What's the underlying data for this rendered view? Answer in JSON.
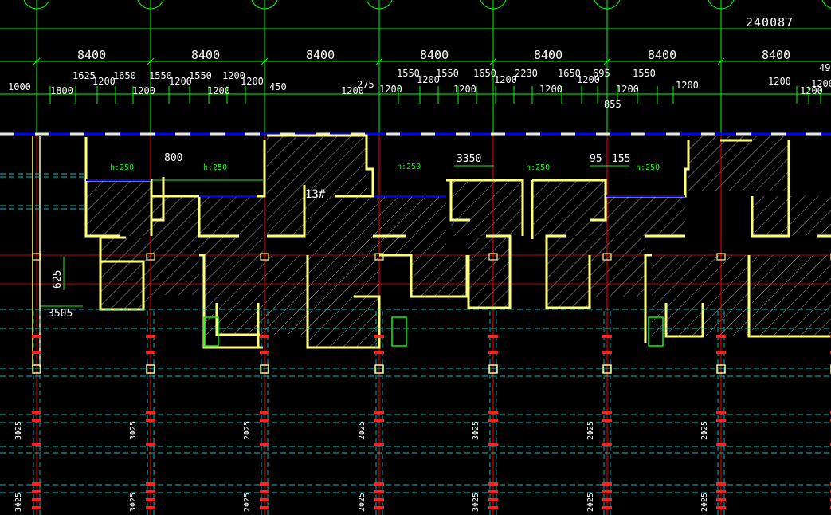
{
  "drawing": {
    "total_dimension": "240087",
    "unit_label": "13#",
    "colors": {
      "background": "#000000",
      "dim_lines": "#00ff00",
      "axis_lines": "#ff0000",
      "walls": "#ffff80",
      "hatch": "#d8d8d8",
      "beam_dashes": "#00c8c8",
      "text": "#ffffff",
      "blue_line": "#0000ff",
      "bar_marks": "#ff2020"
    },
    "bay_dims": [
      "8400",
      "8400",
      "8400",
      "8400",
      "8400",
      "8400",
      "8400"
    ],
    "sub_dims_upper": [
      "1625",
      "1200",
      "1650",
      "1550",
      "1200",
      "1550",
      "1200",
      "1200",
      "1550",
      "1200",
      "1550",
      "1650",
      "1200",
      "2230",
      "1650",
      "1200",
      "695",
      "1550",
      "1200",
      "49"
    ],
    "sub_dims_lower": [
      "1000",
      "1800",
      "1200",
      "1200",
      "450",
      "275",
      "1200",
      "1200",
      "1200",
      "1200",
      "855",
      "1200",
      "1200",
      "1200",
      "1200"
    ],
    "inner_dims": [
      "800",
      "3350",
      "95",
      "155",
      "625",
      "3505"
    ],
    "hood_labels": [
      "h:250",
      "h:250",
      "h:250",
      "h:250",
      "h:250"
    ],
    "rebar_labels": [
      "3Φ25",
      "3Φ25",
      "2Φ25",
      "2Φ25",
      "3Φ25",
      "2Φ25",
      "2Φ25"
    ]
  }
}
